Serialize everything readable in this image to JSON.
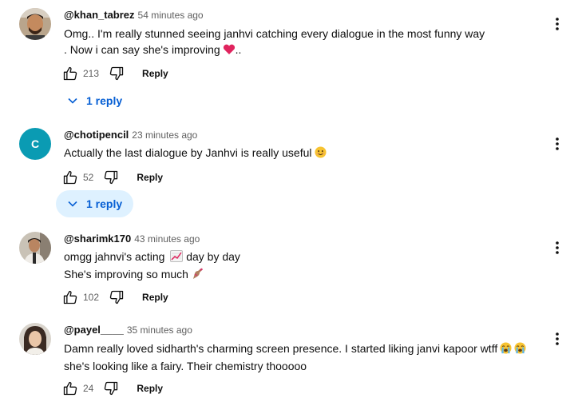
{
  "comments": [
    {
      "author": "@khan_tabrez",
      "time": "54 minutes ago",
      "line1": "Omg.. I'm really stunned seeing janhvi catching every dialogue in the most funny way",
      "line2": ". Now i can say she's improving",
      "line2_suffix": "..",
      "likes": "213",
      "reply_label": "Reply",
      "replies_label": "1 reply"
    },
    {
      "author": "@chotipencil",
      "time": "23 minutes ago",
      "avatar_letter": "C",
      "line1": "Actually the last dialogue by Janhvi is really useful",
      "likes": "52",
      "reply_label": "Reply",
      "replies_label": "1 reply"
    },
    {
      "author": "@sharimk170",
      "time": "43 minutes ago",
      "line1a": "omgg jahnvi's acting",
      "line1b": "day by day",
      "line2": "She's improving so much",
      "likes": "102",
      "reply_label": "Reply"
    },
    {
      "author": "@payel____",
      "time": "35 minutes ago",
      "line1": "Damn really loved sidharth's charming screen presence. I started liking janvi kapoor wtff",
      "line2": "she's looking like a fairy. Their chemistry thooooo",
      "likes": "24",
      "reply_label": "Reply"
    }
  ],
  "colors": {
    "link_blue": "#065fd4",
    "avatar_teal": "#0a9bb3",
    "hover_bg": "#def1ff"
  },
  "icons": [
    "thumb-up-icon",
    "thumb-down-icon",
    "chevron-down-icon",
    "more-vert-icon",
    "heart-emoji",
    "smile-emoji",
    "chart-emoji",
    "nail-polish-emoji",
    "crying-emoji"
  ]
}
